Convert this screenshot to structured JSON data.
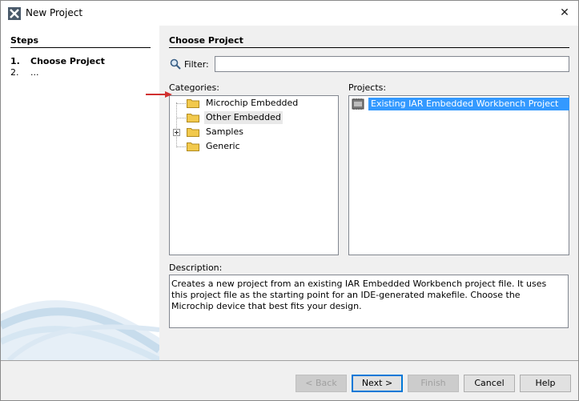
{
  "window": {
    "title": "New Project",
    "close_glyph": "✕"
  },
  "steps": {
    "title": "Steps",
    "items": [
      {
        "num": "1.",
        "label": "Choose Project"
      },
      {
        "num": "2.",
        "label": "..."
      }
    ]
  },
  "main": {
    "title": "Choose Project",
    "filter": {
      "label": "Filter:",
      "value": ""
    },
    "categories": {
      "label": "Categories:",
      "items": [
        {
          "label": "Microchip Embedded"
        },
        {
          "label": "Other Embedded",
          "selected": true
        },
        {
          "label": "Samples",
          "expandable": true
        },
        {
          "label": "Generic"
        }
      ]
    },
    "projects": {
      "label": "Projects:",
      "items": [
        {
          "label": "Existing IAR Embedded Workbench Project",
          "selected": true
        }
      ]
    },
    "description": {
      "label": "Description:",
      "text": "Creates a new project from an existing IAR Embedded Workbench project file. It uses this project file as the starting point for an IDE-generated makefile. Choose the Microchip device that best fits your design."
    }
  },
  "buttons": {
    "back": "< Back",
    "next": "Next >",
    "finish": "Finish",
    "cancel": "Cancel",
    "help": "Help"
  },
  "colors": {
    "selection": "#3399ff",
    "arrow": "#d03030",
    "folder": "#f2c94c"
  }
}
